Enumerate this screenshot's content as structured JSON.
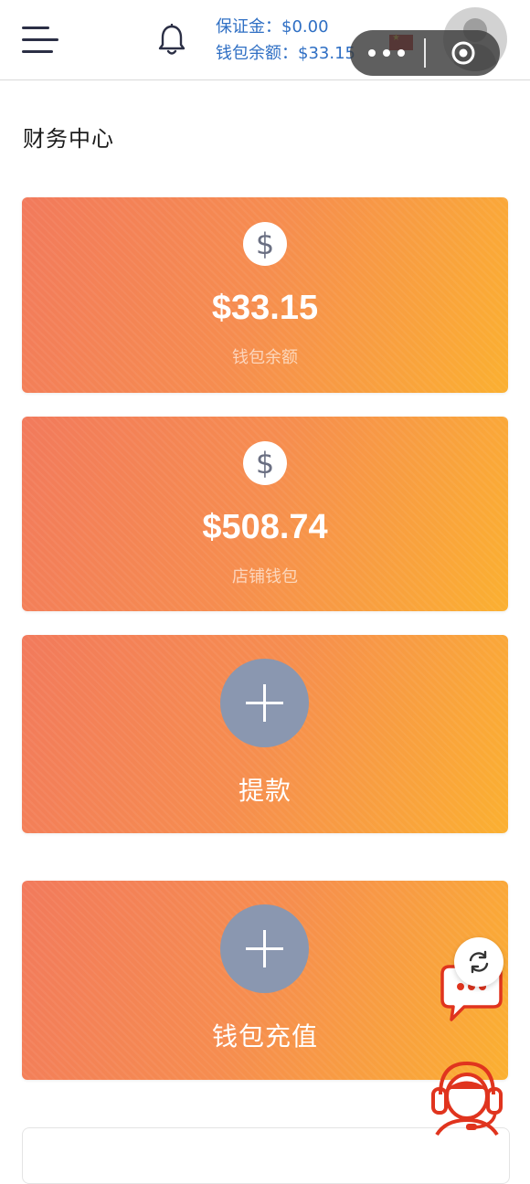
{
  "header": {
    "deposit_label": "保证金：$0.00",
    "wallet_label": "钱包余额：$33.15"
  },
  "page": {
    "title": "财务中心"
  },
  "cards": {
    "wallet_balance": {
      "amount": "$33.15",
      "label": "钱包余额",
      "icon": "dollar-icon"
    },
    "store_wallet": {
      "amount": "$508.74",
      "label": "店铺钱包",
      "icon": "dollar-icon"
    }
  },
  "actions": {
    "withdraw_label": "提款",
    "recharge_label": "钱包充值"
  },
  "icons": {
    "menu": "menu-icon",
    "bell": "bell-icon",
    "flag": "flag-icon",
    "avatar": "avatar",
    "more": "more-icon",
    "target": "target-icon",
    "plus": "plus-icon",
    "refresh": "refresh-icon",
    "chat": "chat-icon",
    "support": "headset-icon"
  },
  "colors": {
    "card_gradient_start": "#f27a5c",
    "card_gradient_end": "#fbb031",
    "balance_text": "#2f6fc4",
    "plus_circle": "#8a97b0",
    "support_red": "#e0341e"
  }
}
